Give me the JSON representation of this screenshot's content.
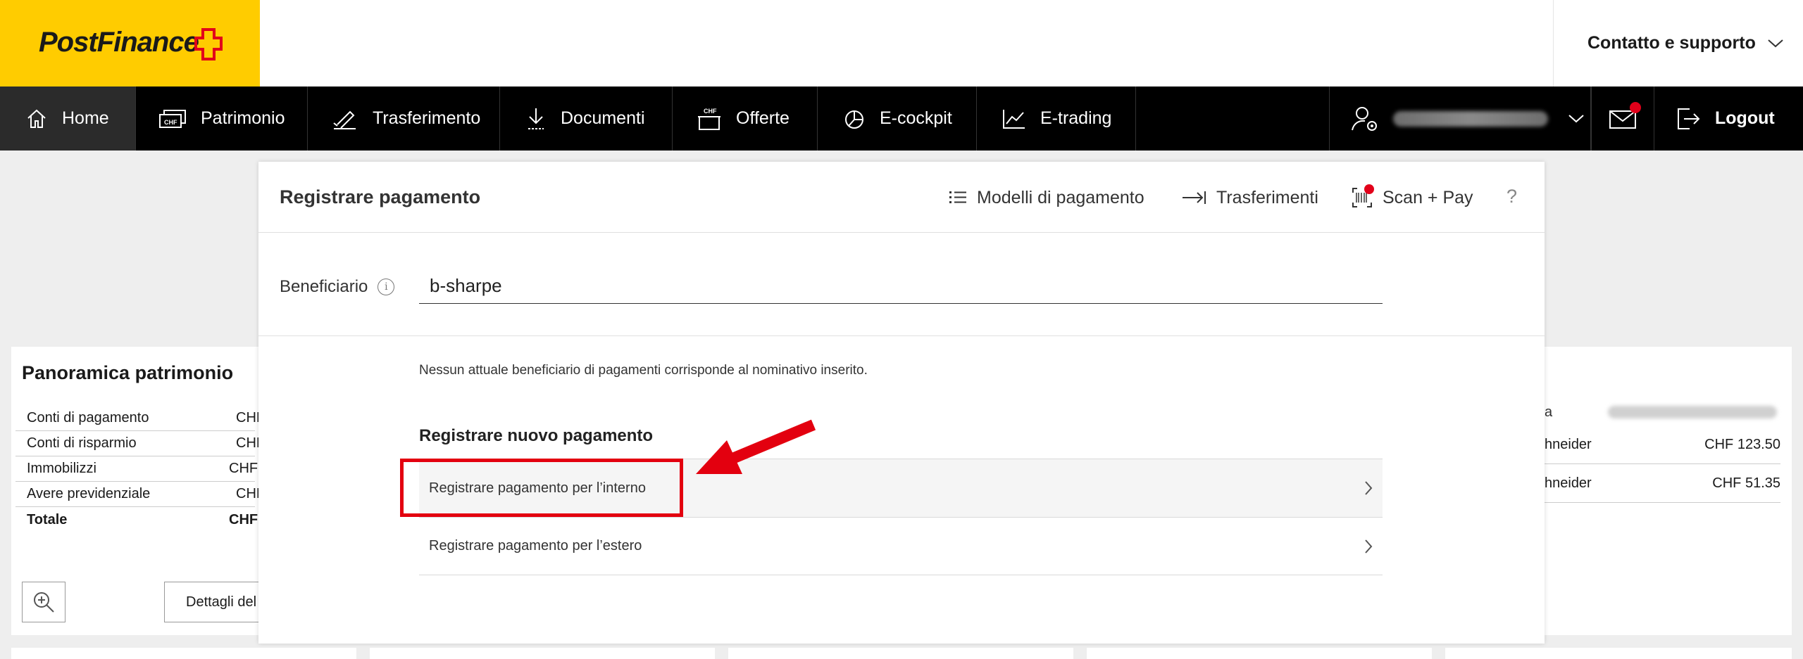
{
  "header": {
    "logo_text": "PostFinance",
    "support_label": "Contatto e supporto"
  },
  "nav": {
    "items": [
      {
        "label": "Home",
        "icon": "home-icon"
      },
      {
        "label": "Patrimonio",
        "icon": "chf-notes-icon"
      },
      {
        "label": "Trasferimento",
        "icon": "sign-pen-icon"
      },
      {
        "label": "Documenti",
        "icon": "download-icon"
      },
      {
        "label": "Offerte",
        "icon": "chf-box-icon"
      },
      {
        "label": "E-cockpit",
        "icon": "pie-chart-icon"
      },
      {
        "label": "E-trading",
        "icon": "trend-chart-icon"
      }
    ],
    "user_icon": "user-settings-icon",
    "mail_icon": "mail-icon",
    "logout_label": "Logout"
  },
  "background": {
    "panel_title": "Panoramica patrimonio",
    "rows": [
      {
        "label": "Conti di pagamento",
        "currency": "CHF"
      },
      {
        "label": "Conti di risparmio",
        "currency": "CHF"
      },
      {
        "label": "Immobilizzi",
        "currency": "CHF"
      },
      {
        "label": "Avere previdenziale",
        "currency": "CHF"
      },
      {
        "label": "Totale",
        "currency": "CHF"
      }
    ],
    "details_button": "Dettagli del p",
    "right_label_partial": "a",
    "right_rows": [
      {
        "name": "hneider",
        "amount": "CHF 123.50"
      },
      {
        "name": "hneider",
        "amount": "CHF 51.35"
      }
    ]
  },
  "modal": {
    "title": "Registrare pagamento",
    "links": {
      "templates": "Modelli di pagamento",
      "transfers": "Trasferimenti",
      "scan_pay": "Scan + Pay",
      "help": "?"
    },
    "beneficiary_label": "Beneficiario",
    "beneficiary_info": "i",
    "beneficiary_value": "b-sharpe",
    "no_match_text": "Nessun attuale beneficiario di pagamenti corrisponde al nominativo inserito.",
    "new_payment_title": "Registrare nuovo pagamento",
    "options": [
      {
        "label": "Registrare pagamento per l’interno"
      },
      {
        "label": "Registrare pagamento per l’estero"
      }
    ]
  },
  "colors": {
    "brand_yellow": "#ffcc00",
    "nav_bg": "#000000",
    "annotation_red": "#e3000f"
  }
}
